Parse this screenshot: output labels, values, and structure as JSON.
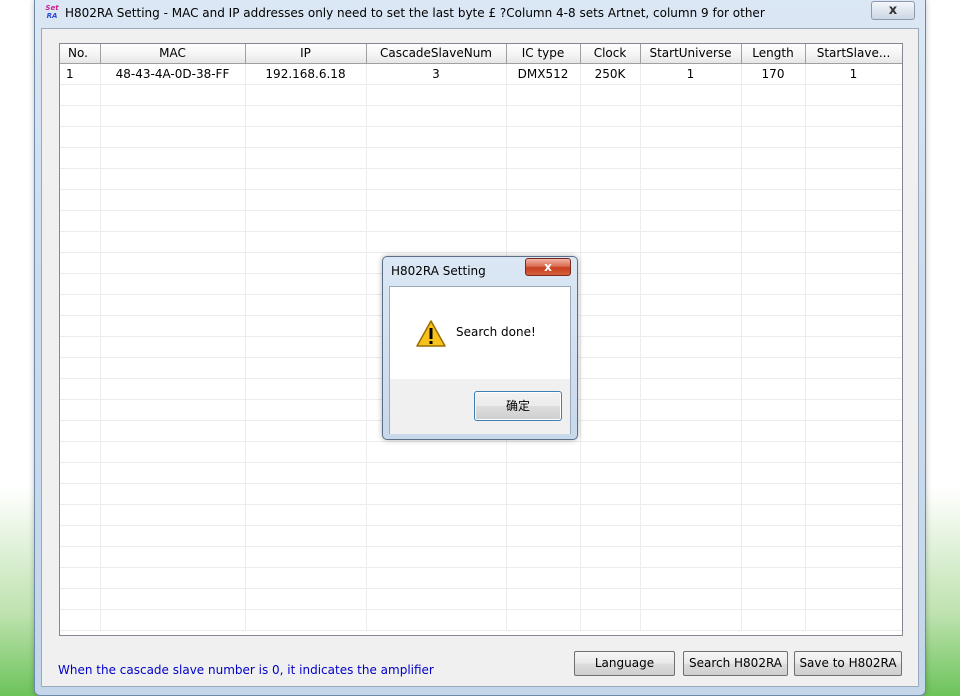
{
  "window": {
    "title": "H802RA Setting - MAC and IP addresses only need to set the last byte £ ?Column 4-8 sets Artnet, column 9 for other",
    "icon_text_top": "Set",
    "icon_text_bottom": "RA",
    "close_label": "x"
  },
  "table": {
    "columns": [
      "No.",
      "MAC",
      "IP",
      "CascadeSlaveNum",
      "IC type",
      "Clock",
      "StartUniverse",
      "Length",
      "StartSlave..."
    ],
    "rows": [
      [
        "1",
        "48-43-4A-0D-38-FF",
        "192.168.6.18",
        "3",
        "DMX512",
        "250K",
        "1",
        "170",
        "1"
      ]
    ],
    "empty_row_count": 26
  },
  "footer": {
    "hint": "When the cascade slave number is 0, it indicates the amplifier",
    "language_button": "Language",
    "search_button": "Search H802RA",
    "save_button": "Save to H802RA"
  },
  "dialog": {
    "title": "H802RA Setting",
    "close_label": "x",
    "icon": "warning-icon",
    "message": "Search done!",
    "ok_button": "确定"
  },
  "colors": {
    "hint_text": "#0000c8",
    "dialog_close": "#c6401f",
    "warning_yellow": "#f6c21b"
  }
}
